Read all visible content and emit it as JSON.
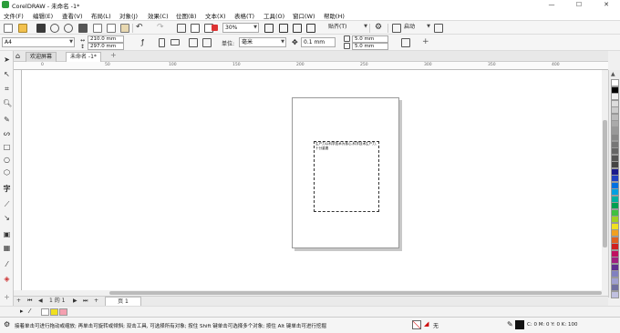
{
  "window": {
    "title": "CorelDRAW - 未命名 -1*"
  },
  "menu": [
    "文件(F)",
    "编辑(E)",
    "查看(V)",
    "布局(L)",
    "对象(J)",
    "效果(C)",
    "位图(B)",
    "文本(X)",
    "表格(T)",
    "工具(O)",
    "窗口(W)",
    "帮助(H)"
  ],
  "toolbar": {
    "zoom": "30%",
    "snap_label": "贴齐(T)",
    "launch_label": "启动"
  },
  "propbar": {
    "paper_size": "A4",
    "width": "210.0 mm",
    "height": "297.0 mm",
    "units_label": "单位:",
    "units_value": "毫米",
    "nudge": "0.1 mm",
    "dup_x": "5.0 mm",
    "dup_y": "5.0 mm"
  },
  "tabs": {
    "welcome": "欢迎屏幕",
    "doc": "未命名 -1*"
  },
  "ruler_labels": [
    "0",
    "50",
    "100",
    "150",
    "200",
    "250",
    "300",
    "350",
    "400"
  ],
  "canvas": {
    "frame_text": "生产力以科学技术为核心,科学技术生产力,十分重要"
  },
  "pagenav": {
    "counter": "1 的 1",
    "page_tab": "页 1"
  },
  "palette": [
    "#ffffff",
    "#000000",
    "#eeeeee",
    "#dddddd",
    "#cccccc",
    "#bbbbbb",
    "#aaaaaa",
    "#999999",
    "#888888",
    "#777777",
    "#666666",
    "#555555",
    "#444444",
    "#1a1a8c",
    "#2040c0",
    "#0070e0",
    "#00a0e0",
    "#00b0a0",
    "#00a050",
    "#40c040",
    "#a0d020",
    "#f0e020",
    "#f0a020",
    "#e06020",
    "#d02020",
    "#c01060",
    "#a02080",
    "#603090",
    "#8080c0",
    "#a0a0d0",
    "#7070a0",
    "#c0c0e0"
  ],
  "status": {
    "message": "接着单击可进行拖动或缩放; 再单击可旋转或倾斜; 双击工具, 可选择所有对象; 按住 Shift 键单击可选择多个对象; 按住 Alt 键单击可进行挖掘",
    "fill_label": "无",
    "color_values": "C: 0 M: 0 Y: 0 K: 100"
  }
}
